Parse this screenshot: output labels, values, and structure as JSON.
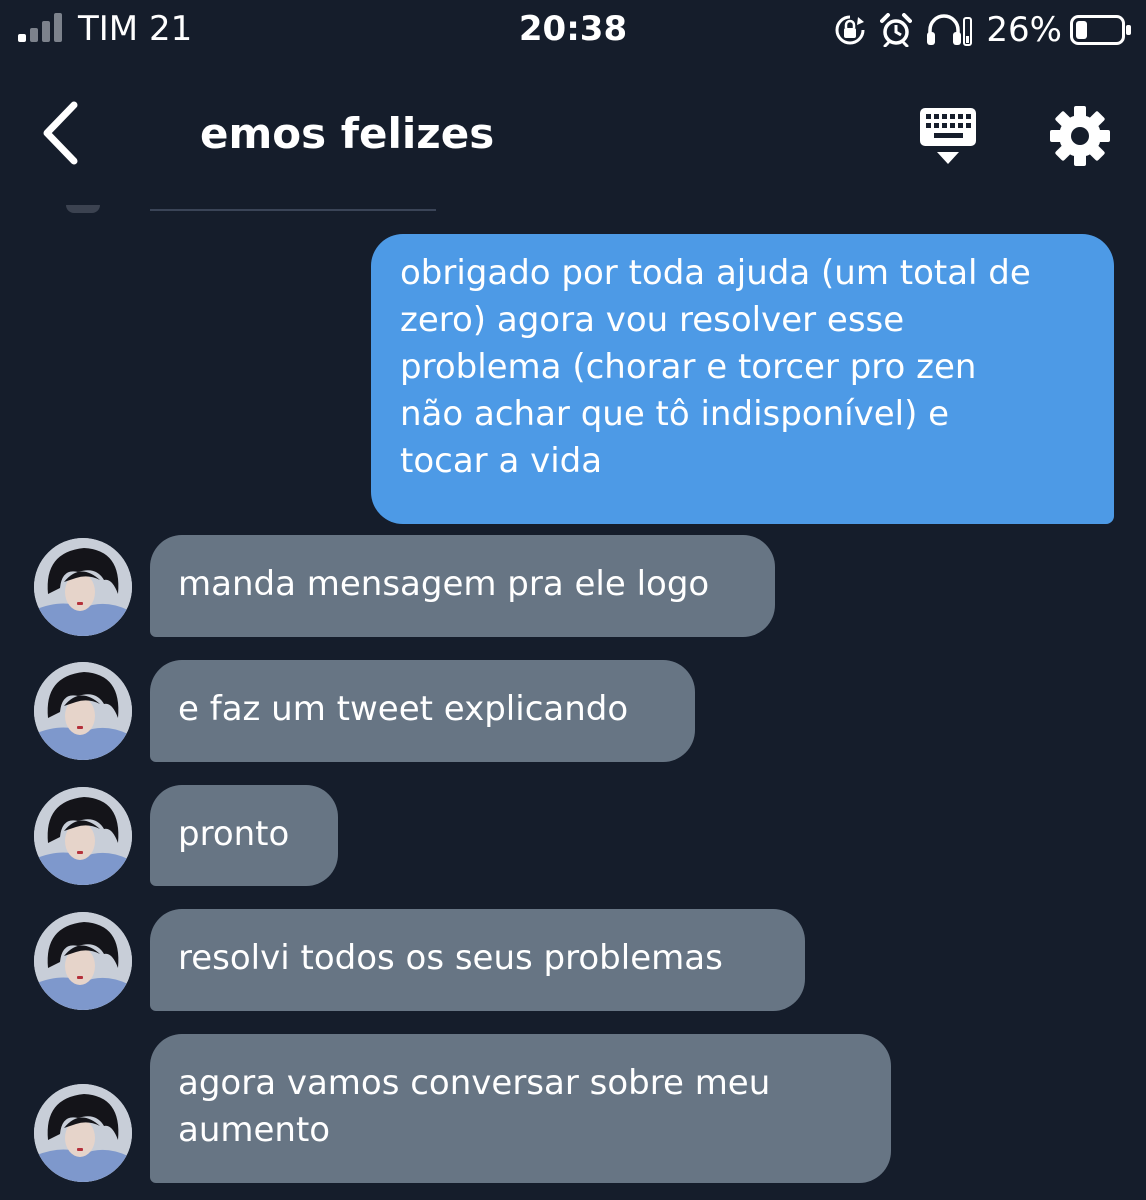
{
  "status_bar": {
    "carrier": "TIM 21",
    "time": "20:38",
    "battery_percent": "26%",
    "battery_level": 0.26,
    "signal_bars_active": 1,
    "icons": [
      "signal-icon",
      "orientation-lock-icon",
      "alarm-icon",
      "headphones-icon",
      "battery-icon"
    ]
  },
  "header": {
    "title": "emos felizes",
    "icons": [
      "back-arrow-icon",
      "keyboard-icon",
      "gear-icon"
    ]
  },
  "messages": [
    {
      "direction": "outgoing",
      "text": "obrigado por toda ajuda (um total de\nzero) agora vou resolver esse\nproblema (chorar e torcer pro zen\nnão achar que tô indisponível) e\ntocar a vida"
    },
    {
      "direction": "incoming",
      "text": "manda mensagem pra ele logo"
    },
    {
      "direction": "incoming",
      "text": "e faz um tweet explicando"
    },
    {
      "direction": "incoming",
      "text": "pronto"
    },
    {
      "direction": "incoming",
      "text": "resolvi todos os seus problemas"
    },
    {
      "direction": "incoming",
      "text": "agora vamos conversar sobre meu\naumento"
    }
  ],
  "colors": {
    "background": "#151d2b",
    "outgoing_bubble": "#4d9ae6",
    "incoming_bubble": "#677584",
    "text": "#ffffff"
  }
}
